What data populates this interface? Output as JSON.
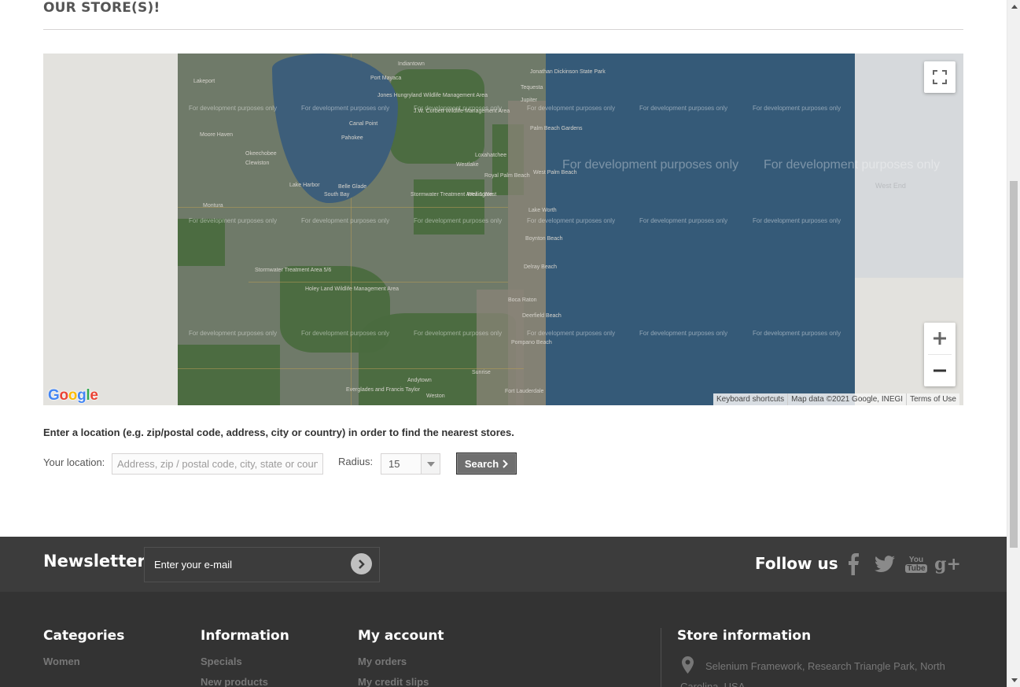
{
  "page": {
    "title": "OUR STORE(S)!"
  },
  "map": {
    "dev_watermark": "For development purposes only",
    "dev_watermark_big": "For development purposes only",
    "dev_watermark_big2": "For development purposes only",
    "places": [
      "Indiantown",
      "Port Mayaca",
      "Jupiter",
      "Tequesta",
      "Okeechobee",
      "Jonathan Dickinson State Park",
      "Moore Haven",
      "Canal Point",
      "Pahokee",
      "Palm Beach Gardens",
      "Lake Harbor",
      "South Bay",
      "Belle Glade",
      "Loxahatchee",
      "Westlake",
      "Royal Palm Beach",
      "West Palm Beach",
      "Wellington",
      "Stormwater Treatment Area 1 West",
      "Lake Worth",
      "Boynton Beach",
      "Delray Beach",
      "Boca Raton",
      "Deerfield Beach",
      "Pompano Beach",
      "Fort Lauderdale",
      "Sunrise",
      "Andytown",
      "Weston",
      "Holey Land Wildlife Management Area",
      "Stormwater Treatment Area 5/6",
      "Everglades and Francis Taylor",
      "Clewiston",
      "Montura",
      "West End",
      "Lakeport",
      "Jones Hungryland Wildlife Management Area",
      "J.W. Corbett Wildlife Management Area"
    ],
    "google_logo": [
      "G",
      "o",
      "o",
      "g",
      "l",
      "e"
    ],
    "google_colors": [
      "#4285f4",
      "#ea4335",
      "#fbbc05",
      "#4285f4",
      "#34a853",
      "#ea4335"
    ],
    "attribution": {
      "keyboard": "Keyboard shortcuts",
      "data": "Map data ©2021 Google, INEGI",
      "terms": "Terms of Use"
    },
    "controls": {
      "fullscreen_icon": "fullscreen-icon",
      "zoom_in": "+",
      "zoom_out": "−"
    }
  },
  "locator": {
    "help": "Enter a location (e.g. zip/postal code, address, city or country) in order to find the nearest stores.",
    "location_label": "Your location:",
    "location_placeholder": "Address, zip / postal code, city, state or country",
    "location_value": "",
    "radius_label": "Radius:",
    "radius_value": "15",
    "search_label": "Search"
  },
  "newsletter": {
    "title": "Newsletter",
    "placeholder": "Enter your e-mail",
    "follow_title": "Follow us",
    "social_icons": [
      "facebook-icon",
      "twitter-icon",
      "youtube-icon",
      "google-plus-icon"
    ],
    "youtube_text": {
      "line1": "You",
      "line2": "Tube"
    },
    "gplus_text": "g+"
  },
  "footer": {
    "categories": {
      "title": "Categories",
      "items": [
        "Women"
      ]
    },
    "information": {
      "title": "Information",
      "items": [
        "Specials",
        "New products"
      ]
    },
    "my_account": {
      "title": "My account",
      "items": [
        "My orders",
        "My credit slips"
      ]
    },
    "store_info": {
      "title": "Store information",
      "address_line1": "Selenium Framework, Research Triangle Park, North",
      "address_line2": "Carolina, USA"
    }
  },
  "colors": {
    "newsletter_bg": "#3c3c3c",
    "footer_bg": "#333333",
    "map_ocean": "#355a78",
    "search_btn": "#6f6f6f"
  }
}
